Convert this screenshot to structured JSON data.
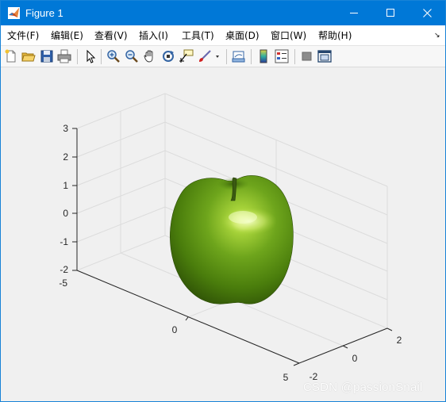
{
  "window": {
    "title": "Figure 1"
  },
  "menu": {
    "items": [
      "文件(F)",
      "编辑(E)",
      "查看(V)",
      "插入(I)",
      "工具(T)",
      "桌面(D)",
      "窗口(W)",
      "帮助(H)"
    ],
    "overflow_icon": "chevron-icon"
  },
  "toolbar": {
    "icons": [
      "new-figure-icon",
      "open-file-icon",
      "save-icon",
      "print-icon",
      "select-arrow-icon",
      "zoom-in-icon",
      "zoom-out-icon",
      "pan-hand-icon",
      "rotate-3d-icon",
      "data-cursor-icon",
      "brush-icon",
      "brush-dropdown-icon",
      "link-plot-icon",
      "colorbar-icon",
      "legend-icon",
      "hide-plot-tools-icon",
      "show-plot-tools-icon"
    ]
  },
  "chart_data": {
    "type": "surface3d",
    "title": "",
    "subject": "apple-shaped surface",
    "x_ticks": [
      "-5",
      "0",
      "5"
    ],
    "y_ticks": [
      "-2",
      "0",
      "2"
    ],
    "z_ticks": [
      "-2",
      "-1",
      "0",
      "1",
      "2",
      "3"
    ],
    "xlim": [
      -5,
      5
    ],
    "ylim": [
      -2,
      2
    ],
    "zlim": [
      -2,
      3
    ],
    "grid": true,
    "colors": {
      "surface": "#5e9a12",
      "highlight": "#dff08a",
      "shadow": "#2a4a05",
      "stem": "#2f4510",
      "grid": "#dcdcdc"
    }
  },
  "watermark": "CSDN @passionSnail"
}
